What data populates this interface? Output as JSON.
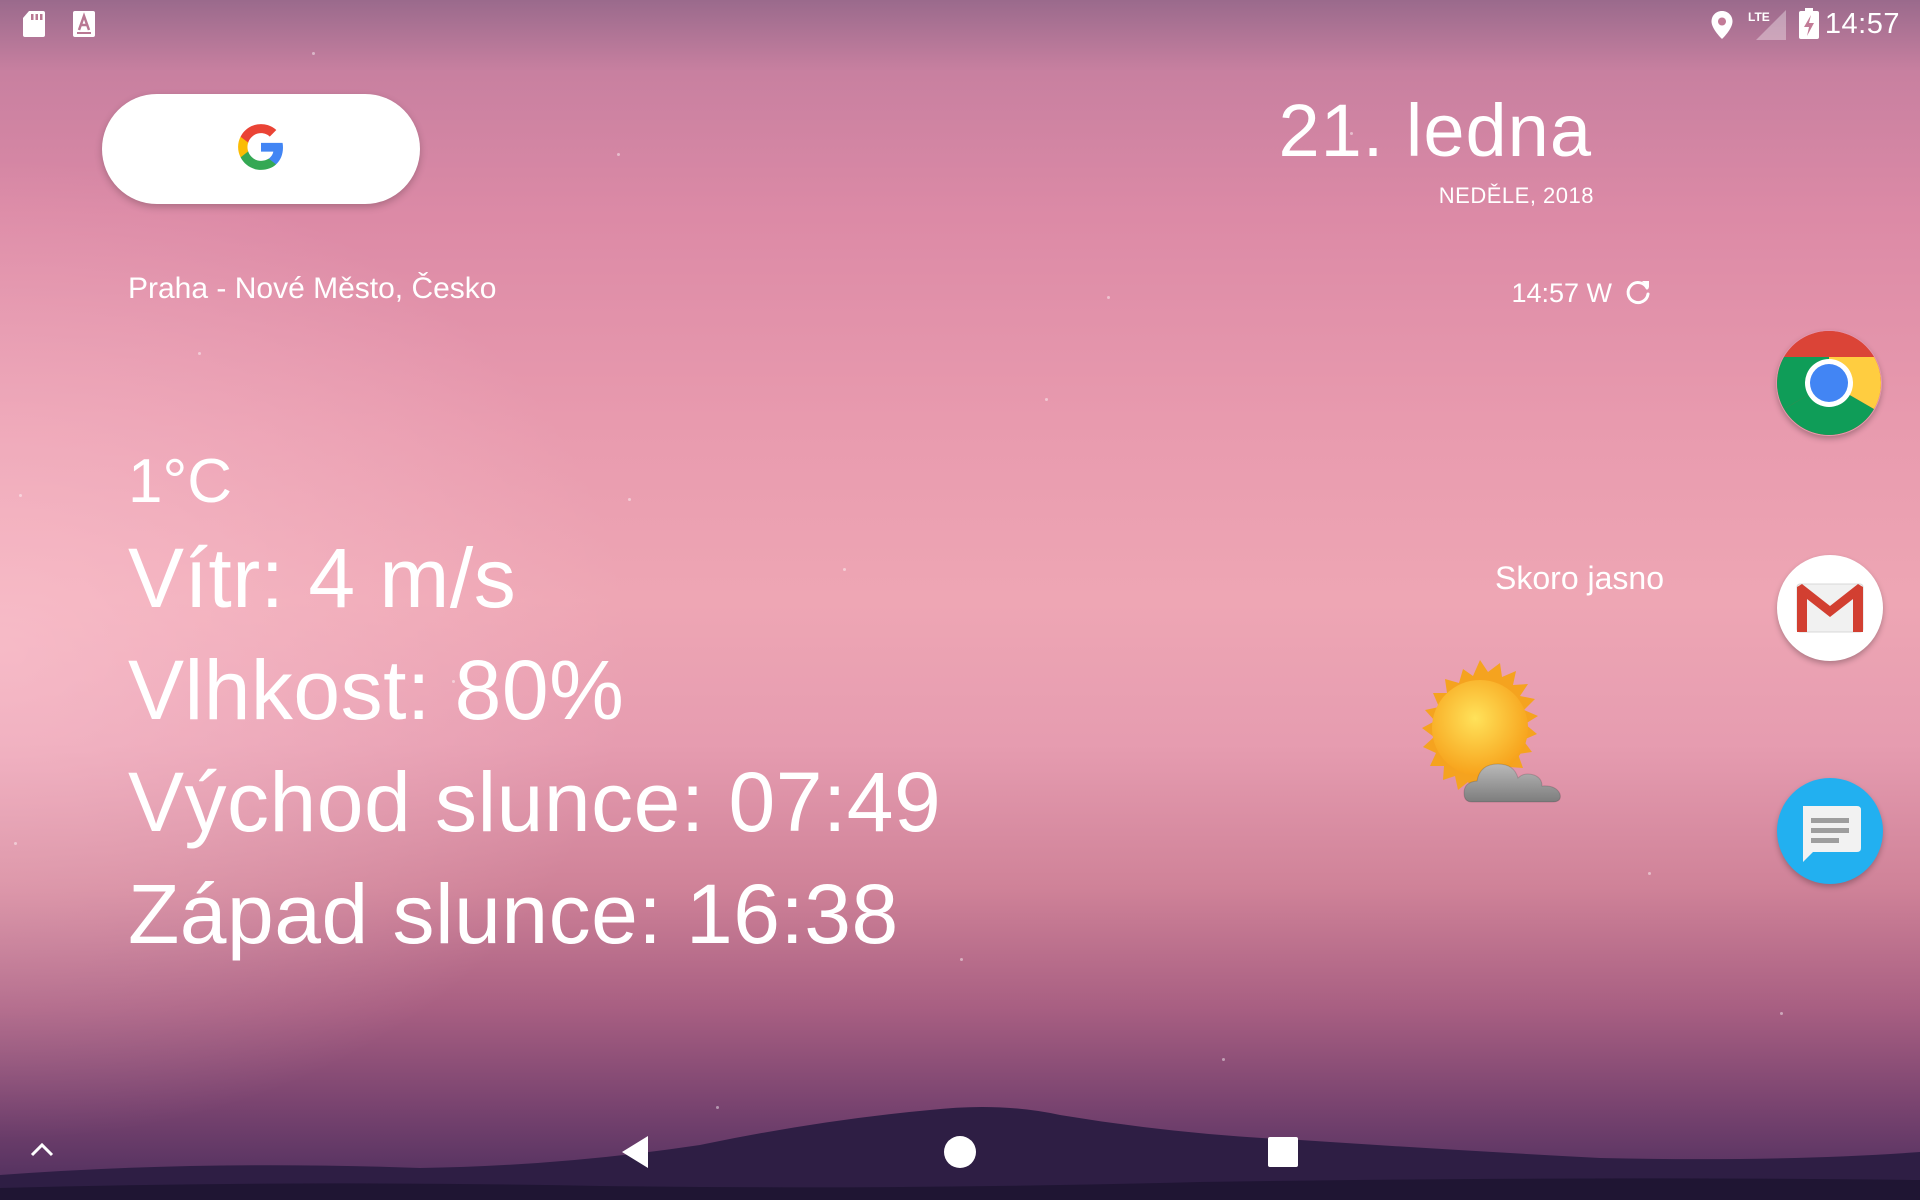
{
  "status_bar": {
    "time": "14:57",
    "network": "LTE",
    "icons": [
      "sd-card-icon",
      "text-a-icon",
      "location-pin-icon",
      "lte-signal-icon",
      "battery-charging-icon"
    ]
  },
  "search_widget": {
    "icon": "google-g-icon"
  },
  "date_widget": {
    "date": "21. ledna",
    "weekday_year": "NEDĚLE, 2018"
  },
  "weather_widget": {
    "location": "Praha - Nové Město, Česko",
    "updated": "14:57 W",
    "temperature": "1°C",
    "wind": "Vítr: 4 m/s",
    "humidity": "Vlhkost: 80%",
    "sunrise": "Východ slunce: 07:49",
    "sunset": "Západ slunce: 16:38",
    "condition": "Skoro jasno",
    "condition_icon": "sun-behind-cloud-icon"
  },
  "dock": [
    {
      "app": "chrome",
      "icon": "chrome-icon"
    },
    {
      "app": "gmail",
      "icon": "gmail-icon"
    },
    {
      "app": "messages",
      "icon": "messages-icon"
    }
  ],
  "nav_bar": {
    "icons": [
      "app-drawer-up-icon",
      "back-icon",
      "home-icon",
      "recents-icon"
    ]
  },
  "colors": {
    "google_blue": "#4285F4",
    "google_red": "#EA4335",
    "google_yellow": "#FBBC05",
    "google_green": "#34A853",
    "messages_blue": "#22B0F0"
  }
}
